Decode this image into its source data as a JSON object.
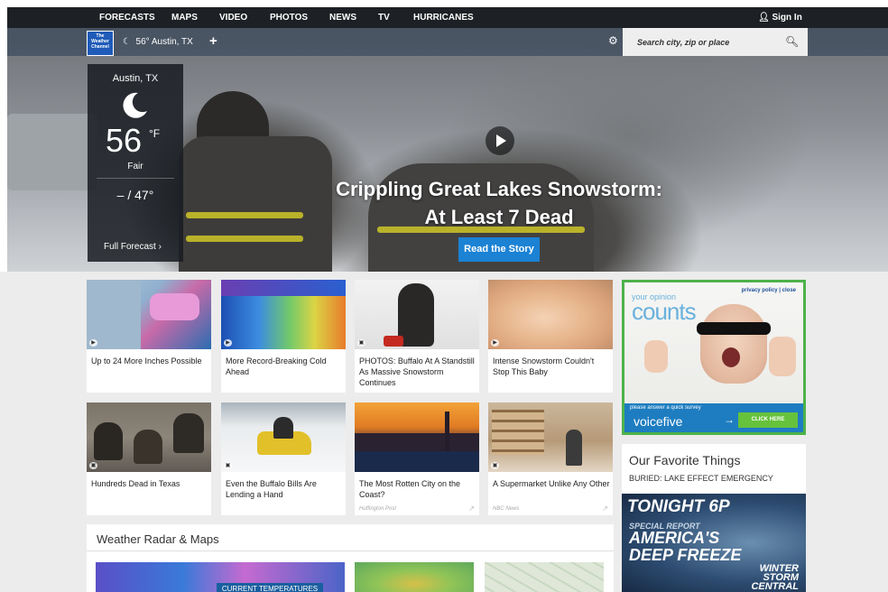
{
  "nav": {
    "items": [
      "FORECASTS",
      "MAPS",
      "VIDEO",
      "PHOTOS",
      "NEWS",
      "TV",
      "HURRICANES"
    ],
    "signin": "Sign In"
  },
  "header": {
    "logo_text": "The Weather Channel",
    "location_chip": "56° Austin, TX",
    "search_placeholder": "Search city, zip or place"
  },
  "current": {
    "city": "Austin, TX",
    "temp": "56",
    "unit": "°F",
    "condition": "Fair",
    "hilo": "– / 47°",
    "full_forecast": "Full Forecast"
  },
  "hero": {
    "headline_line1": "Crippling Great Lakes Snowstorm:",
    "headline_line2": "At Least 7 Dead",
    "cta": "Read the Story"
  },
  "stories_row1": [
    {
      "caption": "Up to 24 More Inches Possible"
    },
    {
      "caption": "More Record-Breaking Cold Ahead"
    },
    {
      "caption": "PHOTOS: Buffalo At A Standstill As Massive Snowstorm Continues"
    },
    {
      "caption": "Intense Snowstorm Couldn't Stop This Baby"
    }
  ],
  "stories_row2": [
    {
      "caption": "Hundreds Dead in Texas",
      "source": ""
    },
    {
      "caption": "Even the Buffalo Bills Are Lending a Hand",
      "source": ""
    },
    {
      "caption": "The Most Rotten City on the Coast?",
      "source": "Huffington Post"
    },
    {
      "caption": "A Supermarket Unlike Any Other",
      "source": "NBC News"
    }
  ],
  "ad": {
    "privacy": "privacy policy | close",
    "your_opinion": "your opinion",
    "counts": "counts",
    "please": "please answer a quick survey",
    "brand": "voicefive",
    "click": "CLICK HERE"
  },
  "favorites": {
    "title": "Our Favorite Things",
    "subtitle": "BURIED: LAKE EFFECT EMERGENCY",
    "promo_time": "TONIGHT 6P",
    "promo_special": "SPECIAL REPORT",
    "promo_title_1": "AMERICA'S",
    "promo_title_2": "DEEP FREEZE",
    "promo_brand_1": "WINTER",
    "promo_brand_2": "STORM",
    "promo_brand_3": "CENTRAL"
  },
  "radar": {
    "title": "Weather Radar & Maps",
    "map1_label": "CURRENT TEMPERATURES"
  }
}
